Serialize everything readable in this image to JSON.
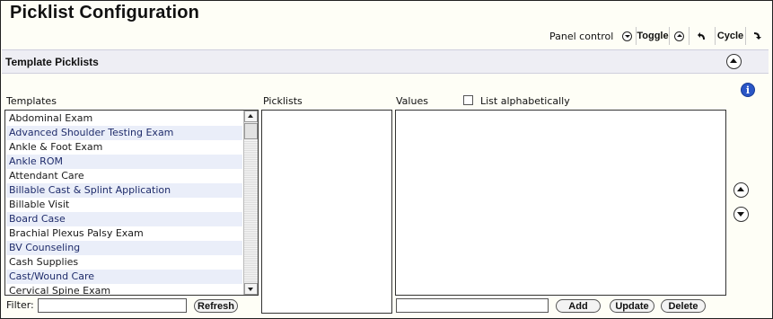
{
  "page_title": "Picklist Configuration",
  "panel_control": {
    "label": "Panel control",
    "toggle_label": "Toggle",
    "cycle_label": "Cycle",
    "icons": [
      "chevron-down-circle-icon",
      "chevron-up-circle-icon",
      "undo-arrow-icon",
      "redo-arrow-icon"
    ]
  },
  "section": {
    "title": "Template Picklists"
  },
  "columns": {
    "templates_label": "Templates",
    "picklists_label": "Picklists",
    "values_label": "Values",
    "list_alphabetically_label": "List alphabetically",
    "list_alphabetically_checked": false
  },
  "templates": [
    "Abdominal Exam",
    "Advanced Shoulder Testing Exam",
    "Ankle & Foot Exam",
    "Ankle ROM",
    "Attendant Care",
    "Billable Cast & Splint Application",
    "Billable Visit",
    "Board Case",
    "Brachial Plexus Palsy Exam",
    "BV Counseling",
    "Cash Supplies",
    "Cast/Wound Care",
    "Cervical Spine Exam"
  ],
  "filter": {
    "label": "Filter:",
    "value": ""
  },
  "buttons": {
    "refresh": "Refresh",
    "add": "Add",
    "update": "Update",
    "delete": "Delete"
  },
  "values_input": {
    "value": ""
  },
  "info_icon_glyph": "i",
  "colors": {
    "header_bar": "#eeeef4",
    "alt_row": "#eaeef9",
    "info_blue": "#2a56c6"
  }
}
